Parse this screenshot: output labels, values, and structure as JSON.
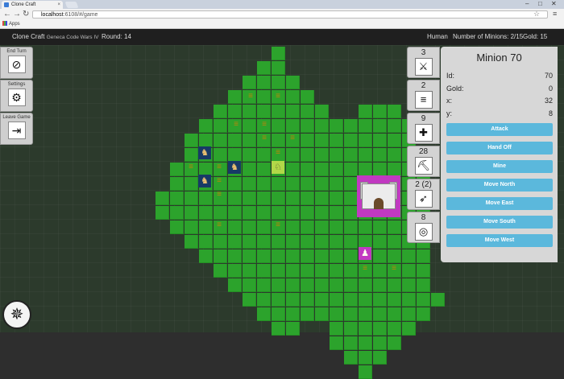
{
  "browser": {
    "tab_title": "Clone Craft",
    "tab_close": "×",
    "url_host": "localhost",
    "url_rest": ":6108/#/game",
    "bookmarks_apps": "Apps"
  },
  "header": {
    "title": "Clone Craft",
    "subtitle": "Geneca Code Wars IV",
    "round_label": "Round: 14",
    "race": "Human",
    "minions_label": "Number of Minions: 2/15",
    "gold_label": "Gold: 15"
  },
  "left_buttons": [
    {
      "label": "End Turn",
      "icon": "no-entry-icon",
      "glyph": "⊘"
    },
    {
      "label": "Settings",
      "icon": "gears-icon",
      "glyph": "⚙"
    },
    {
      "label": "Leave Game",
      "icon": "exit-door-icon",
      "glyph": "⇥"
    }
  ],
  "stats": [
    {
      "value": "3",
      "icon": "scythe-icon",
      "glyph": "⚔"
    },
    {
      "value": "2",
      "icon": "armor-icon",
      "glyph": "≡"
    },
    {
      "value": "9",
      "icon": "health-cross-icon",
      "glyph": "✚"
    },
    {
      "value": "28",
      "icon": "pickaxe-icon",
      "glyph": "⛏"
    },
    {
      "value": "2 (2)",
      "icon": "speed-wing-icon",
      "glyph": "➶"
    },
    {
      "value": "8",
      "icon": "vision-icon",
      "glyph": "◎"
    }
  ],
  "minion_panel": {
    "title": "Minion 70",
    "fields": [
      {
        "label": "Id:",
        "value": "70"
      },
      {
        "label": "Gold:",
        "value": "0"
      },
      {
        "label": "x:",
        "value": "32"
      },
      {
        "label": "y:",
        "value": "8"
      }
    ],
    "actions": [
      "Attack",
      "Hand Off",
      "Mine",
      "Move North",
      "Move East",
      "Move South",
      "Move West"
    ]
  },
  "compass_icon": "compass-icon",
  "colors": {
    "terrain": "#2ca32c",
    "selected_tile": "#b2d848",
    "player_tile": "#173a66",
    "enemy_tile": "#c239c2",
    "action_button": "#5bb8dc"
  }
}
